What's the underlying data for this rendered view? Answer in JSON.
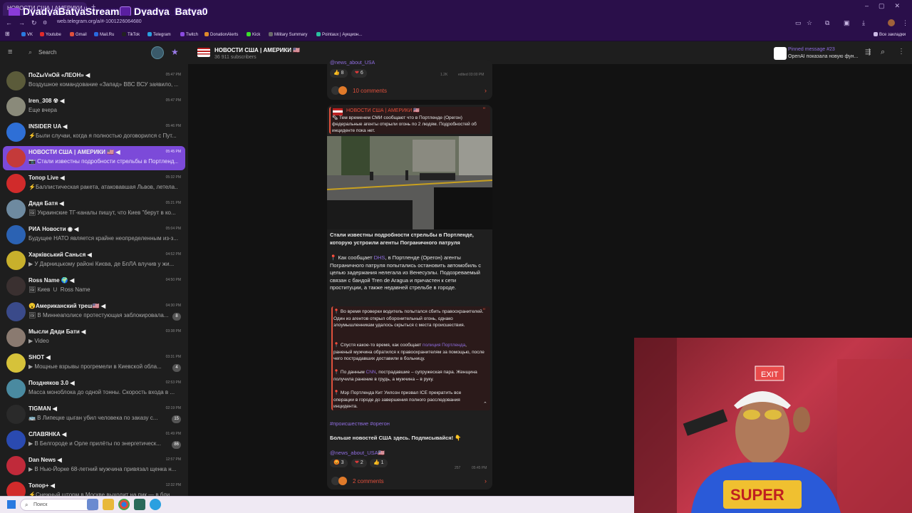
{
  "browser": {
    "tab_title": "НОВОСТИ США | АМЕРИКИ us",
    "url": "web.telegram.org/a/#-1001226064680",
    "bookmarks": [
      "VK",
      "Youtube",
      "Gmail",
      "Mail.Ru",
      "TikTok",
      "Telegram",
      "Twitch",
      "DonationAlerts",
      "Kick",
      "Military Summary",
      "Pointaux | Аукцион..."
    ],
    "all_bookmarks": "Все закладки",
    "overlay_left": "DyadyaBatyaStream",
    "overlay_right": "Dyadya_Batya0"
  },
  "sidebar": {
    "search_placeholder": "Search",
    "chats": [
      {
        "name": "ПоZыVнОй «ЛЕОН» ◀",
        "msg": "Воздушное командование «Запад» ВВС ВСУ заявило, ...",
        "time": "05:47 PM",
        "color": "#5b5b3a",
        "active": false,
        "badge": ""
      },
      {
        "name": "Iren_308 ☢ ◀",
        "msg": "Еще вчера",
        "time": "05:47 PM",
        "color": "#8a8a7a",
        "active": false,
        "badge": ""
      },
      {
        "name": "INSIDER UA ◀",
        "msg": "⚡Были случаи, когда я полностью договорился с Пут...",
        "time": "05:46 PM",
        "color": "#2e6fd6",
        "active": false,
        "badge": ""
      },
      {
        "name": "НОВОСТИ США | АМЕРИКИ 🇺🇸 ◀",
        "msg": "📷 Стали известны подробности стрельбы в Портленд...",
        "time": "05:45 PM",
        "color": "#c43a3a",
        "active": true,
        "badge": ""
      },
      {
        "name": "Топор Live ◀",
        "msg": "⚡Баллистическая ракета, атаковавшая Львов, летела...",
        "time": "05:32 PM",
        "color": "#d12b2b",
        "active": false,
        "badge": ""
      },
      {
        "name": "Дядя Батя ◀",
        "msg": "🖼 Украинские ТГ-каналы пишут, что Киев \"берут в ко...",
        "time": "05:21 PM",
        "color": "#6e8aa0",
        "active": false,
        "badge": ""
      },
      {
        "name": "РИА Новости ◉ ◀",
        "msg": "Будущее НАТО является крайне неопределенным из-з...",
        "time": "05:04 PM",
        "color": "#2b62b3",
        "active": false,
        "badge": ""
      },
      {
        "name": "Харківський Санься ◀",
        "msg": "▶ У Дарницькому районі Києва, де БпЛА влучив у жи...",
        "time": "04:52 PM",
        "color": "#c8b02c",
        "active": false,
        "badge": ""
      },
      {
        "name": "Ross Name 🌍 ◀",
        "msg": "🖼 Киев 🇺 Ross Name",
        "time": "04:50 PM",
        "color": "#3a3030",
        "active": false,
        "badge": ""
      },
      {
        "name": "😮Американский треш🇺🇸 ◀",
        "msg": "🖼 В Миннеаполисе протестующая заблокировала...",
        "time": "04:30 PM",
        "color": "#3a4a8a",
        "active": false,
        "badge": "8"
      },
      {
        "name": "Мысли Дяди Бати ◀",
        "msg": "▶ Video",
        "time": "03:38 PM",
        "color": "#8a7a70",
        "active": false,
        "badge": ""
      },
      {
        "name": "SHOT ◀",
        "msg": "▶ Мощные взрывы прогремели в Киевской обла...",
        "time": "03:31 PM",
        "color": "#d6c23a",
        "active": false,
        "badge": "4"
      },
      {
        "name": "Поздняков 3.0 ◀",
        "msg": "Масса моноблока до одной тонны. Скорость входа в ...",
        "time": "02:53 PM",
        "color": "#4a8aa0",
        "active": false,
        "badge": ""
      },
      {
        "name": "TIGMAN ◀",
        "msg": "🚌 В Липецке цыган убил человека по заказу с...",
        "time": "02:19 PM",
        "color": "#2a2a2a",
        "active": false,
        "badge": "15"
      },
      {
        "name": "СЛАВЯНКА ◀",
        "msg": "▶ В Белгороде и Орле прилёты по энергетическ...",
        "time": "01:49 PM",
        "color": "#2a4ab0",
        "active": false,
        "badge": "86"
      },
      {
        "name": "Dan News ◀",
        "msg": "▶ В Нью-Йорке 68-летний мужчина привязал щенка н...",
        "time": "12:57 PM",
        "color": "#c02a3a",
        "active": false,
        "badge": ""
      },
      {
        "name": "Топор+ ◀",
        "msg": "⚡Снежный шторм в Москве выходит на пик — в бли...",
        "time": "12:32 PM",
        "color": "#d12b2b",
        "active": false,
        "badge": ""
      }
    ]
  },
  "chat": {
    "title": "НОВОСТИ США | АМЕРИКИ 🇺🇸",
    "subscribers": "36 911 subscribers",
    "pinned_label": "Pinned message #23",
    "pinned_text": "OpenAI показала новую фун..."
  },
  "post1": {
    "handle": "@news_about_USA",
    "reactions": [
      {
        "emoji": "👍",
        "count": "8"
      },
      {
        "emoji": "❤",
        "count": "6"
      }
    ],
    "views": "1.2K",
    "meta": "edited 03:00 PM",
    "comments": "10 comments"
  },
  "post2": {
    "fwd_channel": "НОВОСТИ США | АМЕРИКИ 🇺🇸",
    "fwd_text": "🗞 Тем временем СМИ сообщают что в Портленде (Орегон) федеральные агенты открыли огонь по 2 людям. Подробностей об инциденте пока нет.",
    "headline": "Стали известны подробности стрельбы в Портленде, которую устроили агенты Пограничного патруля",
    "body_pre": "📍 Как сообщает ",
    "body_link": "DHS",
    "body_post": ", в Портленде (Орегон) агенты Пограничного патруля попытались остановить автомобиль с целью задержания нелегала из Венесуэлы. Подозреваемый связан с бандой Tren de Aragua и причастен к сети проституции, а также недавней стрельбе в городе.",
    "quote1": "📍 Во время проверки водитель попытался сбить правоохранителей. Один из агентов открыл оборонительный огонь, однако злоумышленникам удалось скрыться с места происшествия.",
    "quote2_pre": "📍 Спустя какое-то время, как сообщает ",
    "quote2_link": "полиция Портленда",
    "quote2_post": ", раненый мужчина обратился к правоохранителям за помощью, после чего пострадавших доставили в больницу.",
    "quote3_pre": "📍 По данным ",
    "quote3_link": "CNN",
    "quote3_post": ", пострадавшие – супружеская пара. Женщина получила ранение в грудь, а мужчина – в руку.",
    "quote4": "📍 Мэр Портленда Кит Уилсон призвал ICE прекратить все операции в городе до завершения полного расследования инцидента.",
    "hashtags": "#происшествие #орегон",
    "cta": "Больше новостей США здесь. Подписывайся! 👇",
    "handle": "@news_about_USA🇺🇸",
    "reactions": [
      {
        "emoji": "😡",
        "count": "3"
      },
      {
        "emoji": "❤",
        "count": "2"
      },
      {
        "emoji": "👍",
        "count": "1"
      }
    ],
    "views": "257",
    "time": "05:45 PM",
    "comments": "2 comments"
  },
  "taskbar": {
    "search_placeholder": "Поиск"
  },
  "colors": {
    "accent": "#7c4ad9",
    "link": "#8f6de0",
    "comment": "#e0503c",
    "chrome": "#2a0f4a"
  }
}
